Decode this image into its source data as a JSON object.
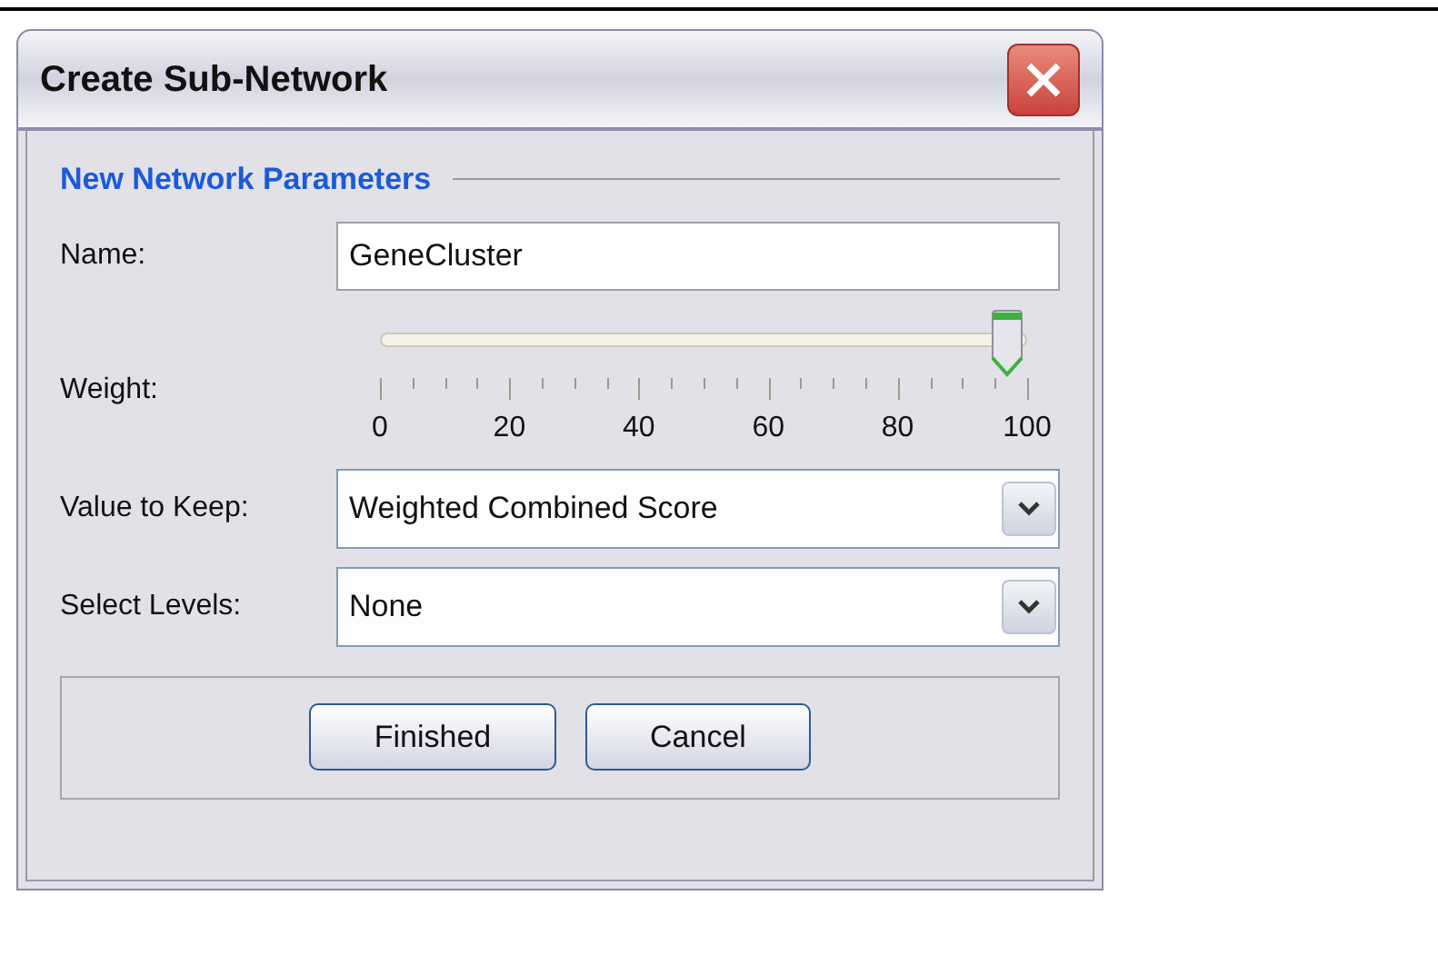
{
  "window": {
    "title": "Create Sub-Network"
  },
  "group": {
    "title": "New Network Parameters"
  },
  "name_field": {
    "label": "Name:",
    "value": "GeneCluster"
  },
  "weight": {
    "label": "Weight:",
    "tick_labels": [
      "0",
      "20",
      "40",
      "60",
      "80",
      "100"
    ]
  },
  "dropdowns": [
    {
      "label": "Value to Keep:",
      "value": "Weighted Combined Score"
    },
    {
      "label": "Select Levels:",
      "value": "None"
    }
  ],
  "buttons": [
    "Finished",
    "Cancel"
  ]
}
